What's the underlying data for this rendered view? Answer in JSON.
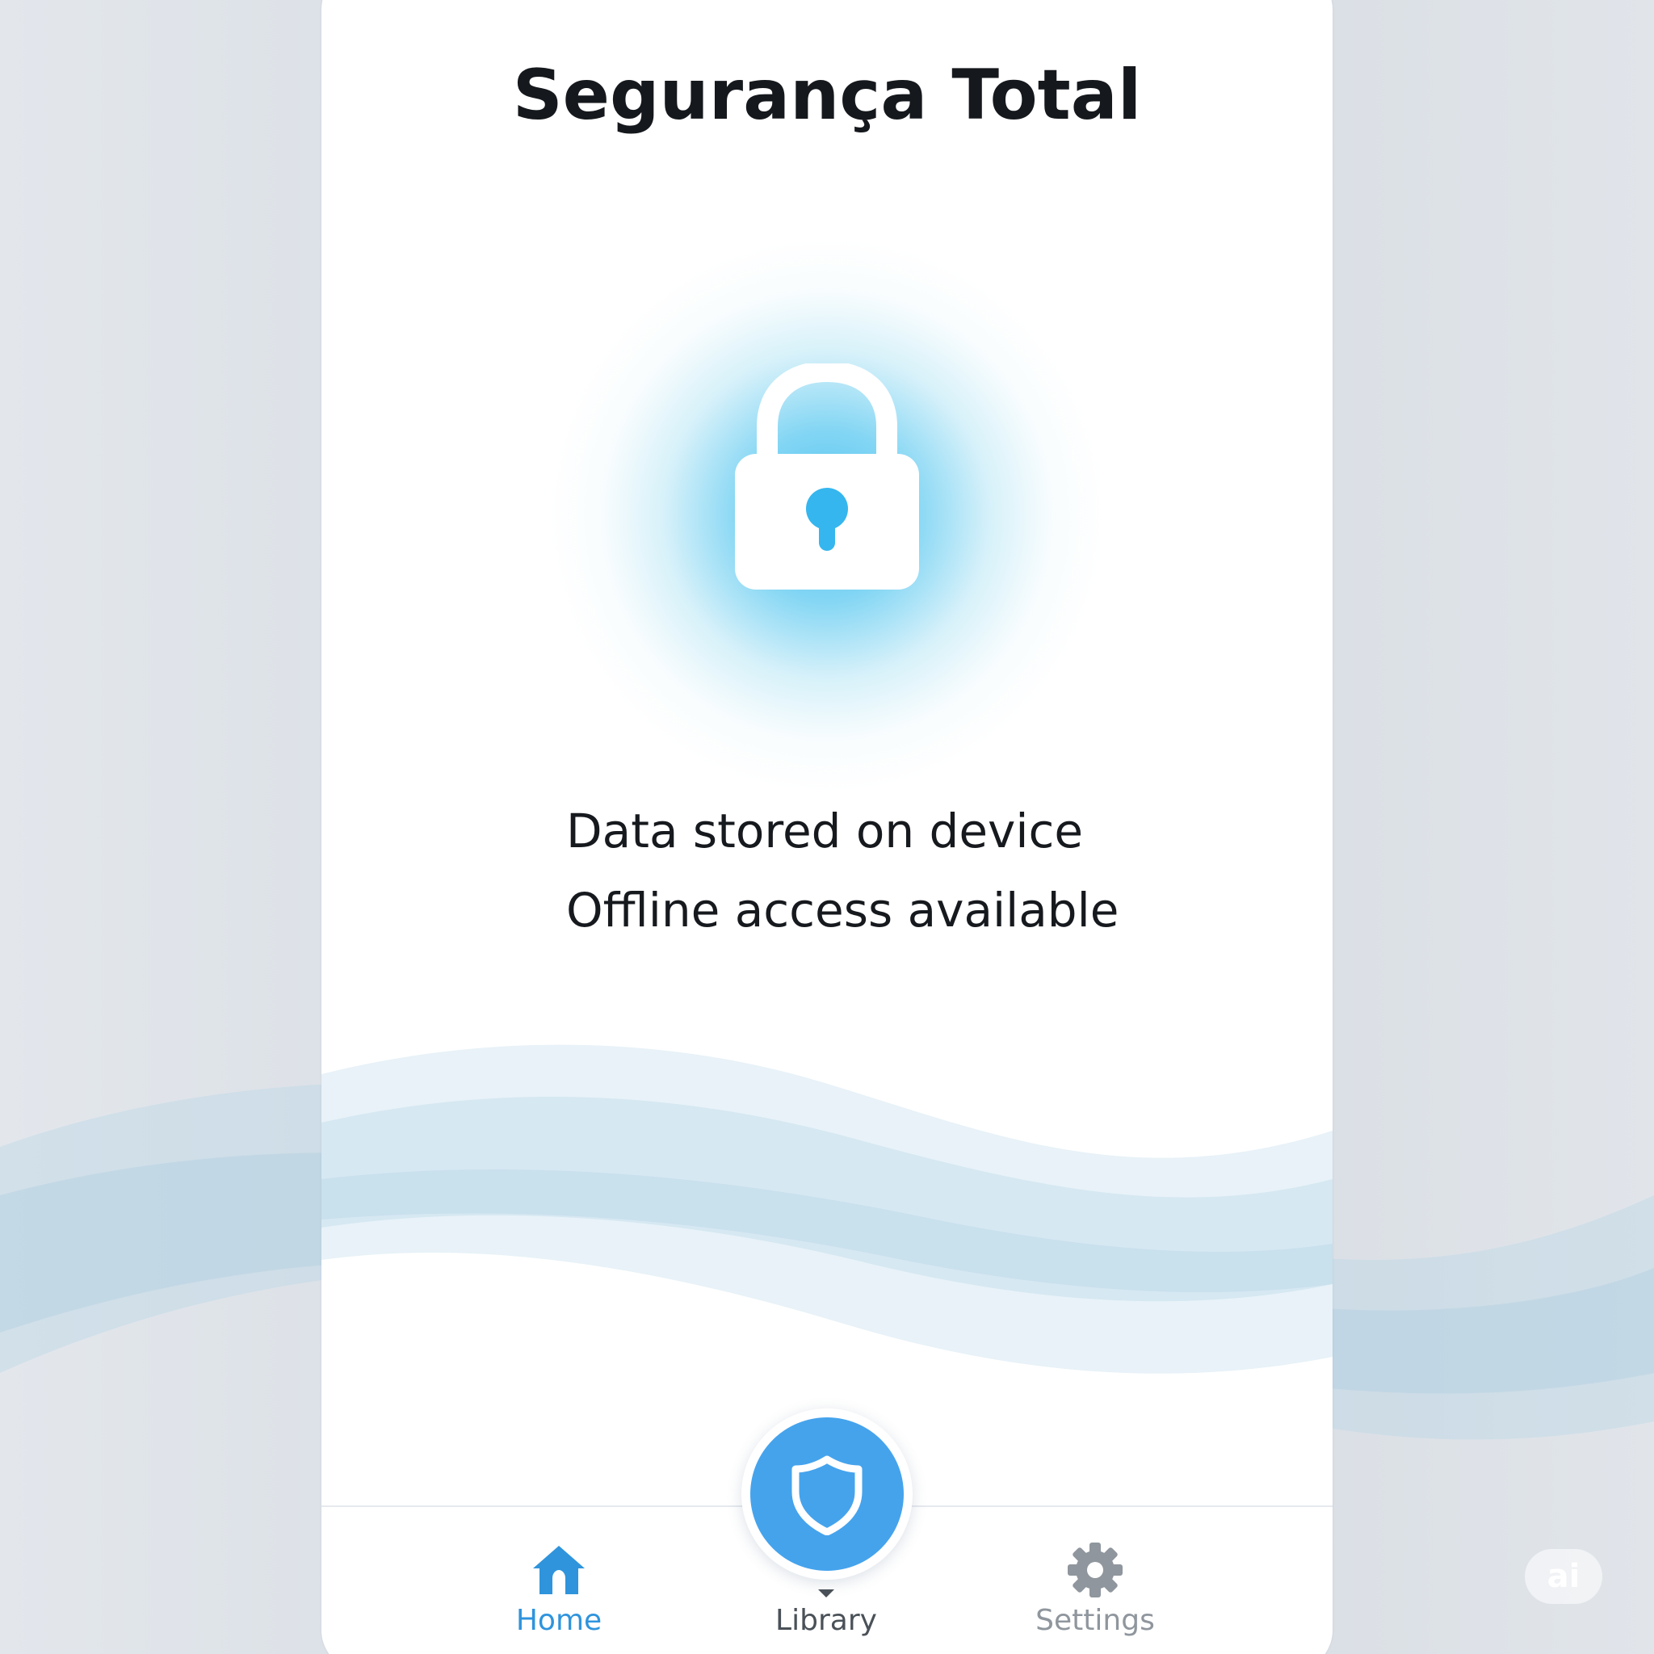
{
  "app": {
    "title": "Segurança Total"
  },
  "hero": {
    "icon": "lock-icon",
    "accent_color": "#46BEF0"
  },
  "info": {
    "lines": [
      "Data stored on device",
      "Offline access available"
    ]
  },
  "fab": {
    "icon": "shield-icon",
    "color": "#45A3EC"
  },
  "tabbar": {
    "active": "Home",
    "tabs": [
      {
        "label": "Home",
        "icon": "home-icon"
      },
      {
        "label": "Library",
        "icon": "library-icon"
      },
      {
        "label": "Settings",
        "icon": "gear-icon"
      }
    ]
  },
  "watermark": {
    "text": "ai"
  }
}
